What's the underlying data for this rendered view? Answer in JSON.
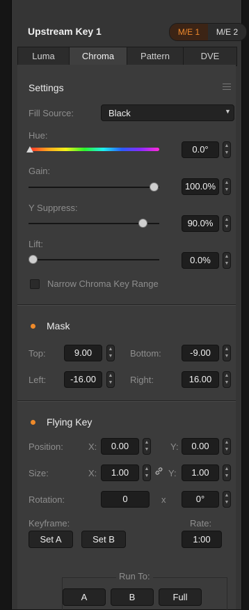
{
  "header": {
    "title": "Upstream Key 1",
    "me_buttons": [
      "M/E 1",
      "M/E 2"
    ]
  },
  "tabs": [
    "Luma",
    "Chroma",
    "Pattern",
    "DVE"
  ],
  "settings": {
    "title": "Settings",
    "fill_source": {
      "label": "Fill Source:",
      "value": "Black"
    },
    "hue": {
      "label": "Hue:",
      "value": "0.0°",
      "level": 0.0
    },
    "gain": {
      "label": "Gain:",
      "value": "100.0%",
      "level": 1.0
    },
    "y_suppress": {
      "label": "Y Suppress:",
      "value": "90.0%",
      "level": 0.9
    },
    "lift": {
      "label": "Lift:",
      "value": "0.0%",
      "level": 0.0
    },
    "narrow_range": {
      "label": "Narrow Chroma Key Range",
      "checked": false
    }
  },
  "mask": {
    "title": "Mask",
    "top": {
      "label": "Top:",
      "value": "9.00"
    },
    "bottom": {
      "label": "Bottom:",
      "value": "-9.00"
    },
    "left": {
      "label": "Left:",
      "value": "-16.00"
    },
    "right": {
      "label": "Right:",
      "value": "16.00"
    }
  },
  "flying_key": {
    "title": "Flying Key",
    "position": {
      "label": "Position:",
      "x_label": "X:",
      "x": "0.00",
      "y_label": "Y:",
      "y": "0.00"
    },
    "size": {
      "label": "Size:",
      "x_label": "X:",
      "x": "1.00",
      "y_label": "Y:",
      "y": "1.00"
    },
    "rotation": {
      "label": "Rotation:",
      "value": "0",
      "x_sep": "x",
      "degrees": "0°"
    },
    "keyframe": {
      "label": "Keyframe:",
      "set_a": "Set A",
      "set_b": "Set B"
    },
    "rate": {
      "label": "Rate:",
      "value": "1:00"
    },
    "run_to": {
      "label": "Run To:",
      "buttons": [
        "A",
        "B",
        "Full"
      ]
    }
  },
  "colors": {
    "accent": "#ef8a2a",
    "panel": "#3b3b3b",
    "field": "#1e1e1e"
  }
}
